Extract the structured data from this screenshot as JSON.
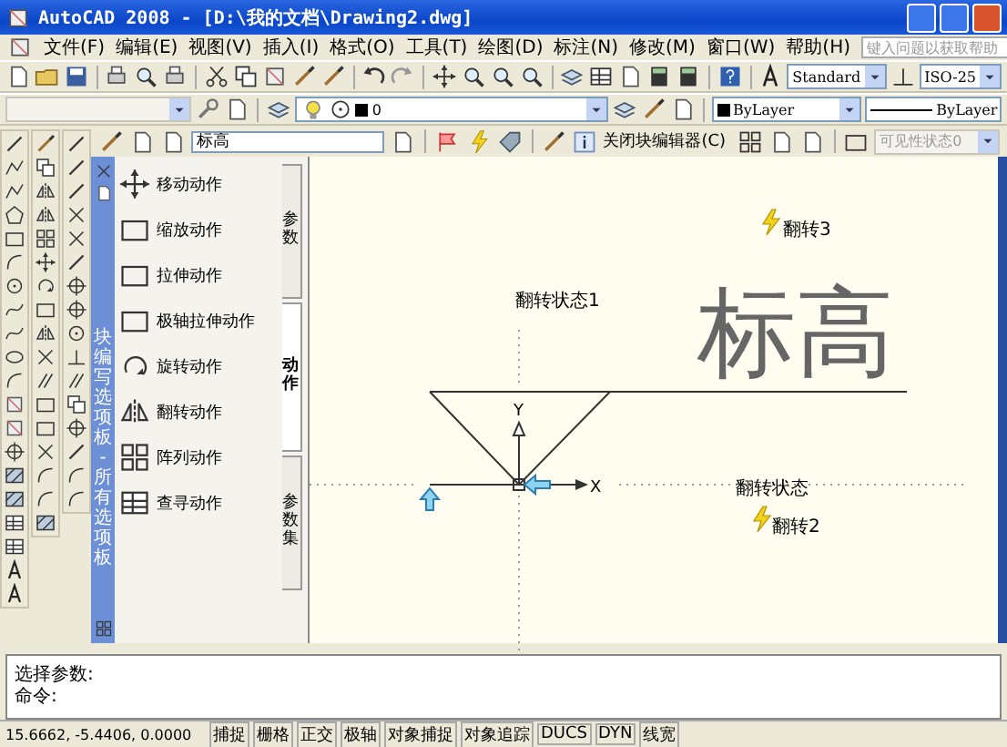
{
  "window": {
    "title": "AutoCAD 2008 - [D:\\我的文档\\Drawing2.dwg]"
  },
  "menu": [
    "文件(F)",
    "编辑(E)",
    "视图(V)",
    "插入(I)",
    "格式(O)",
    "工具(T)",
    "绘图(D)",
    "标注(N)",
    "修改(M)",
    "窗口(W)",
    "帮助(H)"
  ],
  "help_search": {
    "placeholder": "键入问题以获取帮助"
  },
  "styles_toolbar": {
    "text_style": "Standard",
    "dim_style": "ISO-25"
  },
  "properties_toolbar": {
    "layer": "0",
    "object_color": "ByLayer",
    "linetype": "ByLayer"
  },
  "block_editor": {
    "block_name": "标高",
    "close_button": "关闭块编辑器(C)",
    "visibility_state": {
      "value": "可见性状态0",
      "disabled": true
    }
  },
  "palette": {
    "title": "块编写选项板 - 所有选项板",
    "tabs": [
      {
        "label": "参数",
        "selected": false
      },
      {
        "label": "动作",
        "selected": true
      },
      {
        "label": "参数集",
        "selected": false
      }
    ],
    "items": [
      "移动动作",
      "缩放动作",
      "拉伸动作",
      "极轴拉伸动作",
      "旋转动作",
      "翻转动作",
      "阵列动作",
      "查寻动作"
    ]
  },
  "canvas": {
    "flip_state_1": "翻转状态1",
    "flip_3": "翻转3",
    "big_text": "标高",
    "flip_state": "翻转状态",
    "flip_2": "翻转2",
    "axis_y": "Y",
    "axis_x": "X"
  },
  "command_line": {
    "lines": [
      "选择参数:",
      "命令:"
    ]
  },
  "status_bar": {
    "coordinates": "15.6662, -5.4406, 0.0000",
    "toggles": [
      "捕捉",
      "栅格",
      "正交",
      "极轴",
      "对象捕捉",
      "对象追踪",
      "DUCS",
      "DYN",
      "线宽"
    ]
  }
}
